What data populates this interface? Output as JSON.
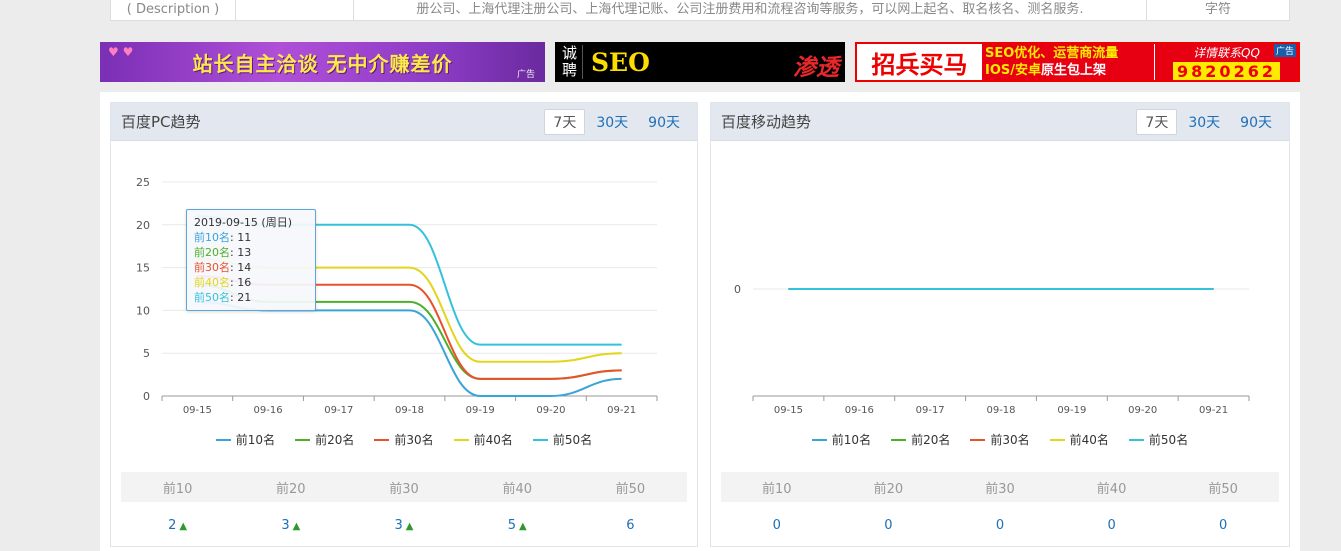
{
  "description_row": {
    "label": "( Description )",
    "text": "册公司、上海代理注册公司、上海代理记账、公司注册费用和流程咨询等服务，可以网上起名、取名核名、测名服务.",
    "count": "字符"
  },
  "ads": {
    "ad1_text": "站长自主洽谈 无中介赚差价",
    "ad1_tag": "广告",
    "ad2_vertical": "诚聘",
    "ad2_seo": "SEO",
    "ad2_red": "渗透",
    "ad3_left": "招兵买马",
    "ad3_line1": "SEO优化、运营商流量",
    "ad3_line2a": "IOS/安卓",
    "ad3_line2b": "原生包上架",
    "ad3_contact": "详情联系QQ",
    "ad3_qq": "9820262",
    "ad3_tag": "广告"
  },
  "pc_panel": {
    "title": "百度PC趋势",
    "tabs": [
      "7天",
      "30天",
      "90天"
    ],
    "active_tab": "7天",
    "tooltip": {
      "title": "2019-09-15 (周日)",
      "lines": [
        {
          "name": "前10名",
          "value": "11"
        },
        {
          "name": "前20名",
          "value": "13"
        },
        {
          "name": "前30名",
          "value": "14"
        },
        {
          "name": "前40名",
          "value": "16"
        },
        {
          "name": "前50名",
          "value": "21"
        }
      ]
    },
    "stats_headers": [
      "前10",
      "前20",
      "前30",
      "前40",
      "前50"
    ],
    "stats_values": [
      "2",
      "3",
      "3",
      "5",
      "6"
    ],
    "stats_trend": [
      "up",
      "up",
      "up",
      "up",
      ""
    ]
  },
  "mobile_panel": {
    "title": "百度移动趋势",
    "tabs": [
      "7天",
      "30天",
      "90天"
    ],
    "active_tab": "7天",
    "stats_headers": [
      "前10",
      "前20",
      "前30",
      "前40",
      "前50"
    ],
    "stats_values": [
      "0",
      "0",
      "0",
      "0",
      "0"
    ]
  },
  "chart_data": [
    {
      "type": "line",
      "title": "",
      "x": [
        "09-15",
        "09-16",
        "09-17",
        "09-18",
        "09-19",
        "09-20",
        "09-21"
      ],
      "ylim": [
        0,
        25
      ],
      "yticks": [
        0,
        5,
        10,
        15,
        20,
        25
      ],
      "grid": true,
      "legend_position": "bottom",
      "series": [
        {
          "name": "前10名",
          "color": "#3aa3d8",
          "values": [
            11,
            10,
            10,
            10,
            0,
            0,
            2
          ]
        },
        {
          "name": "前20名",
          "color": "#4caf2a",
          "values": [
            13,
            11,
            11,
            11,
            2,
            2,
            3
          ]
        },
        {
          "name": "前30名",
          "color": "#e8512a",
          "values": [
            14,
            13,
            13,
            13,
            2,
            2,
            3
          ]
        },
        {
          "name": "前40名",
          "color": "#e3d41c",
          "values": [
            16,
            15,
            15,
            15,
            4,
            4,
            5
          ]
        },
        {
          "name": "前50名",
          "color": "#33c2dc",
          "values": [
            21,
            20,
            20,
            20,
            6,
            6,
            6
          ]
        }
      ]
    },
    {
      "type": "line",
      "title": "",
      "x": [
        "09-15",
        "09-16",
        "09-17",
        "09-18",
        "09-19",
        "09-20",
        "09-21"
      ],
      "yticks": [
        0
      ],
      "grid": true,
      "legend_position": "bottom",
      "series": [
        {
          "name": "前10名",
          "color": "#3aa3d8",
          "values": [
            0,
            0,
            0,
            0,
            0,
            0,
            0
          ]
        },
        {
          "name": "前20名",
          "color": "#4caf2a",
          "values": [
            0,
            0,
            0,
            0,
            0,
            0,
            0
          ]
        },
        {
          "name": "前30名",
          "color": "#e8512a",
          "values": [
            0,
            0,
            0,
            0,
            0,
            0,
            0
          ]
        },
        {
          "name": "前40名",
          "color": "#e3d41c",
          "values": [
            0,
            0,
            0,
            0,
            0,
            0,
            0
          ]
        },
        {
          "name": "前50名",
          "color": "#33c2dc",
          "values": [
            0,
            0,
            0,
            0,
            0,
            0,
            0
          ]
        }
      ]
    }
  ]
}
